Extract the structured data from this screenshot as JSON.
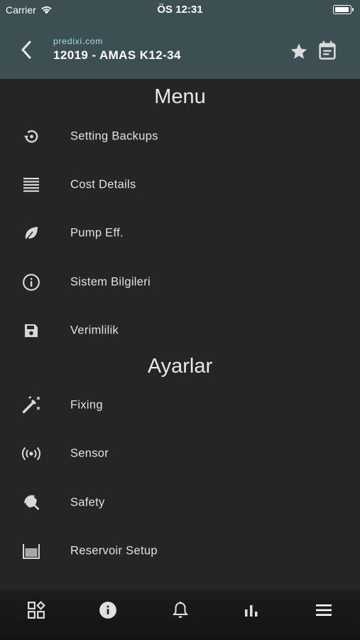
{
  "status_bar": {
    "carrier": "Carrier",
    "time": "ÖS 12:31"
  },
  "header": {
    "site": "predixi.com",
    "title": "12019 - AMAS K12-34",
    "icons": [
      "chevron-left-icon",
      "star-icon",
      "calendar-icon"
    ]
  },
  "sections": [
    {
      "title": "Menu",
      "items": [
        {
          "label": "Setting Backups",
          "icon": "restore-icon"
        },
        {
          "label": "Cost Details",
          "icon": "list-lines-icon"
        },
        {
          "label": "Pump Eff.",
          "icon": "leaf-icon"
        },
        {
          "label": "Sistem Bilgileri",
          "icon": "info-outline-icon"
        },
        {
          "label": "Verimlilik",
          "icon": "save-icon"
        }
      ]
    },
    {
      "title": "Ayarlar",
      "items": [
        {
          "label": "Fixing",
          "icon": "magic-wand-icon"
        },
        {
          "label": "Sensor",
          "icon": "broadcast-icon"
        },
        {
          "label": "Safety",
          "icon": "umbrella-icon"
        },
        {
          "label": "Reservoir Setup",
          "icon": "container-icon"
        }
      ]
    }
  ],
  "tab_bar": {
    "tabs": [
      "dashboard-icon",
      "info-icon",
      "bell-icon",
      "bar-chart-icon",
      "menu-icon"
    ],
    "active": "menu-icon"
  },
  "colors": {
    "header_bg": "#3c5054",
    "body_bg": "#252525",
    "site_text": "#9fe3e6",
    "text": "#e2e2e2",
    "icon": "#d8d8d8"
  }
}
